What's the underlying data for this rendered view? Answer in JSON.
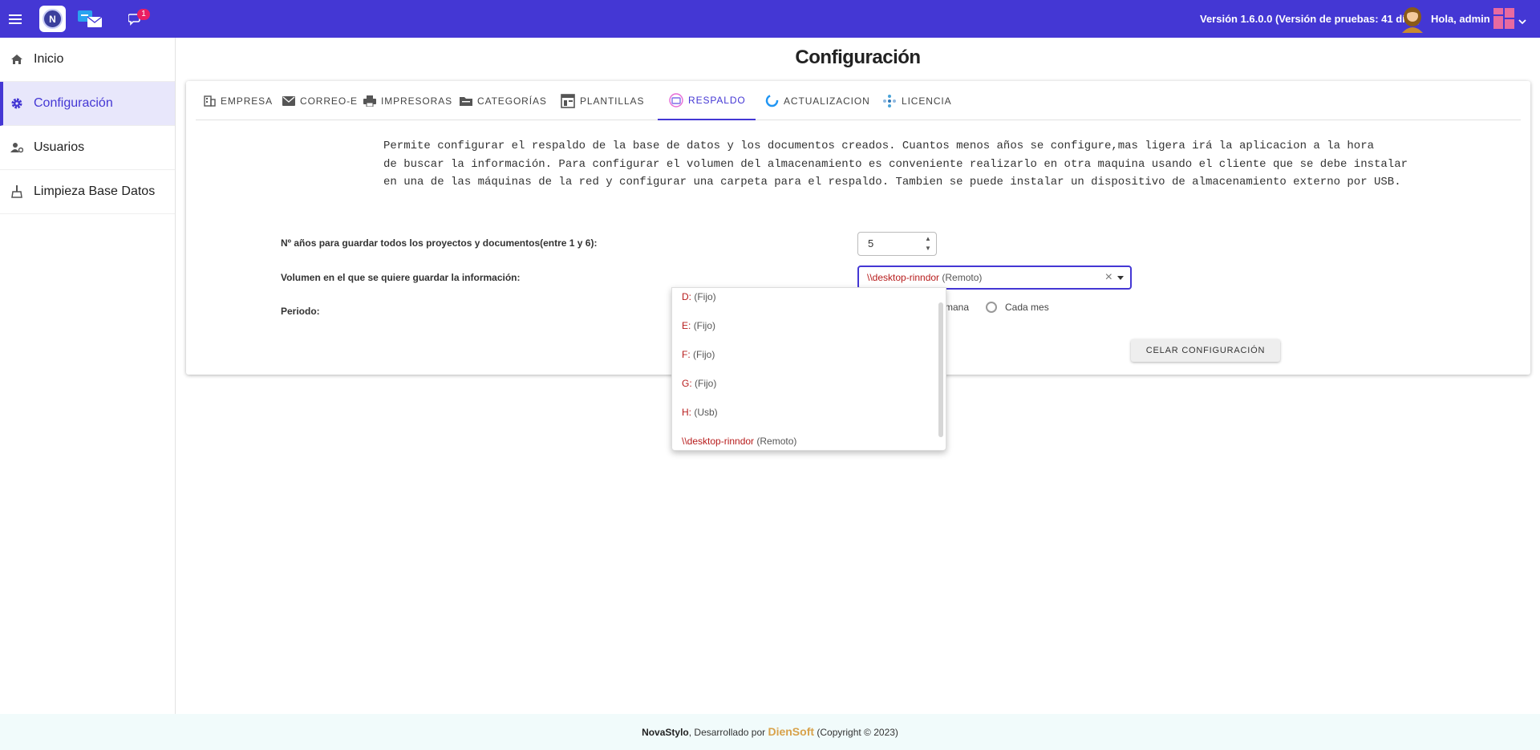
{
  "header": {
    "version": "Versión 1.6.0.0 (Versión de pruebas: 41 días)",
    "greeting": "Hola, admin",
    "notification_count": "1",
    "colors": {
      "primary": "#4437d4",
      "badge": "#e91e63"
    }
  },
  "sidebar": {
    "items": [
      {
        "label": "Inicio",
        "icon": "home-icon"
      },
      {
        "label": "Configuración",
        "icon": "gear-icon"
      },
      {
        "label": "Usuarios",
        "icon": "user-settings-icon"
      },
      {
        "label": "Limpieza Base Datos",
        "icon": "broom-icon"
      }
    ]
  },
  "main": {
    "title": "Configuración",
    "tabs": [
      {
        "label": "EMPRESA",
        "icon": "building-icon"
      },
      {
        "label": "CORREO-E",
        "icon": "mail-icon"
      },
      {
        "label": "IMPRESORAS",
        "icon": "printer-icon"
      },
      {
        "label": "CATEGORÍAS",
        "icon": "folder-icon"
      },
      {
        "label": "PLANTILLAS",
        "icon": "template-icon"
      },
      {
        "label": "RESPALDO",
        "icon": "backup-icon"
      },
      {
        "label": "ACTUALIZACION",
        "icon": "update-icon"
      },
      {
        "label": "LICENCIA",
        "icon": "license-icon"
      }
    ],
    "description": [
      "Permite configurar el respaldo de la base de datos y los documentos creados. Cuantos menos años se configure,mas ligera irá la aplicacion a la hora",
      "de buscar la información. Para configurar el volumen del almacenamiento es conveniente realizarlo en otra maquina usando el cliente que se debe instalar",
      "en una de las máquinas de la red y configurar una carpeta para el respaldo. Tambien se puede instalar un dispositivo de almacenamiento externo por USB."
    ],
    "form": {
      "years_label": "Nº años para guardar todos los proyectos y documentos(entre 1 y 6):",
      "years_value": "5",
      "volume_label": "Volumen en el que se quiere guardar la información:",
      "volume_selected_drive": "\\\\desktop-rinndor",
      "volume_selected_type": "(Remoto)",
      "period_label": "Periodo:",
      "period_partial_option": "mana",
      "period_monthly": "Cada mes",
      "cancel_label": "CELAR CONFIGURACIÓN"
    },
    "dropdown_options": [
      {
        "drive": "D:",
        "type": "(Fijo)"
      },
      {
        "drive": "E:",
        "type": "(Fijo)"
      },
      {
        "drive": "F:",
        "type": "(Fijo)"
      },
      {
        "drive": "G:",
        "type": "(Fijo)"
      },
      {
        "drive": "H:",
        "type": "(Usb)"
      },
      {
        "drive": "\\\\desktop-rinndor",
        "type": "(Remoto)"
      }
    ]
  },
  "footer": {
    "app": "NovaStylo",
    "middle": ", Desarrollado por ",
    "brand": "DienSoft",
    "copyright": " (Copyright © 2023)"
  }
}
